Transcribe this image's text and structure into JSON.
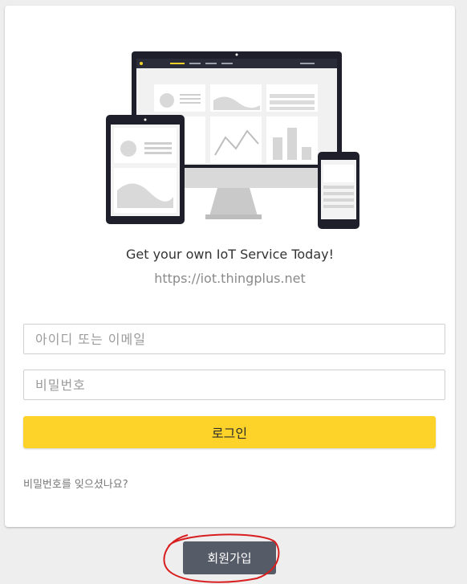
{
  "hero": {
    "tagline": "Get your own IoT Service Today!",
    "url": "https://iot.thingplus.net"
  },
  "login_form": {
    "id_placeholder": "아이디 또는 이메일",
    "password_placeholder": "비밀번호",
    "login_label": "로그인",
    "forgot_password_label": "비밀번호를 잊으셨나요?"
  },
  "signup": {
    "label": "회원가입"
  },
  "colors": {
    "accent": "#fdd32a",
    "signup_button": "#555b67",
    "annotation": "#d81e1e"
  }
}
